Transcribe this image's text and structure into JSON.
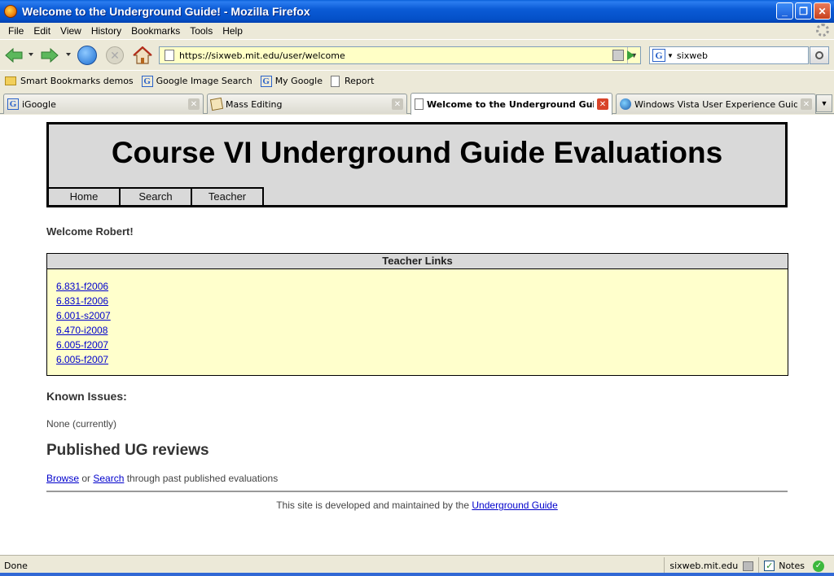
{
  "window": {
    "title": "Welcome to the Underground Guide! - Mozilla Firefox",
    "minimize": "_",
    "restore": "❐",
    "close": "✕"
  },
  "menu": [
    "File",
    "Edit",
    "View",
    "History",
    "Bookmarks",
    "Tools",
    "Help"
  ],
  "nav": {
    "url": "https://sixweb.mit.edu/user/welcome",
    "search_value": "sixweb",
    "search_engine_glyph": "G",
    "icons": [
      "back-icon",
      "forward-icon",
      "reload-icon",
      "stop-icon",
      "home-icon",
      "go-icon",
      "search-icon"
    ]
  },
  "bookmarks": [
    {
      "label": "Smart Bookmarks demos",
      "icon": "folder-icon"
    },
    {
      "label": "Google Image Search",
      "icon": "google-icon"
    },
    {
      "label": "My Google",
      "icon": "google-icon"
    },
    {
      "label": "Report",
      "icon": "page-icon"
    }
  ],
  "tabs": [
    {
      "label": "iGoogle",
      "icon": "google-icon"
    },
    {
      "label": "Mass Editing",
      "icon": "note-icon"
    },
    {
      "label": "Welcome to the Underground Gui...",
      "icon": "page-icon"
    },
    {
      "label": "Windows Vista User Experience Guideli...",
      "icon": "vista-icon"
    }
  ],
  "page": {
    "site_title": "Course VI Underground Guide Evaluations",
    "site_nav": [
      "Home",
      "Search",
      "Teacher"
    ],
    "welcome": "Welcome Robert!",
    "teacher_links_header": "Teacher Links",
    "teacher_links": [
      "6.831-f2006",
      "6.831-f2006",
      "6.001-s2007",
      "6.470-i2008",
      "6.005-f2007",
      "6.005-f2007"
    ],
    "known_issues_heading": "Known Issues:",
    "known_issues_text": "None (currently)",
    "published_heading": "Published UG reviews",
    "browse_link": "Browse",
    "or_text": " or ",
    "search_link": "Search",
    "published_suffix": " through past published evaluations",
    "footer_text": "This site is developed and maintained by the ",
    "footer_link": "Underground Guide"
  },
  "status": {
    "text": "Done",
    "domain": "sixweb.mit.edu",
    "notes_label": "Notes"
  },
  "colors": {
    "titlebar": "#0b5bd6",
    "url_bg": "#ffffc6",
    "links_box_bg": "#ffffcc",
    "link": "#0000cc",
    "banner_bg": "#d9d9d9"
  }
}
